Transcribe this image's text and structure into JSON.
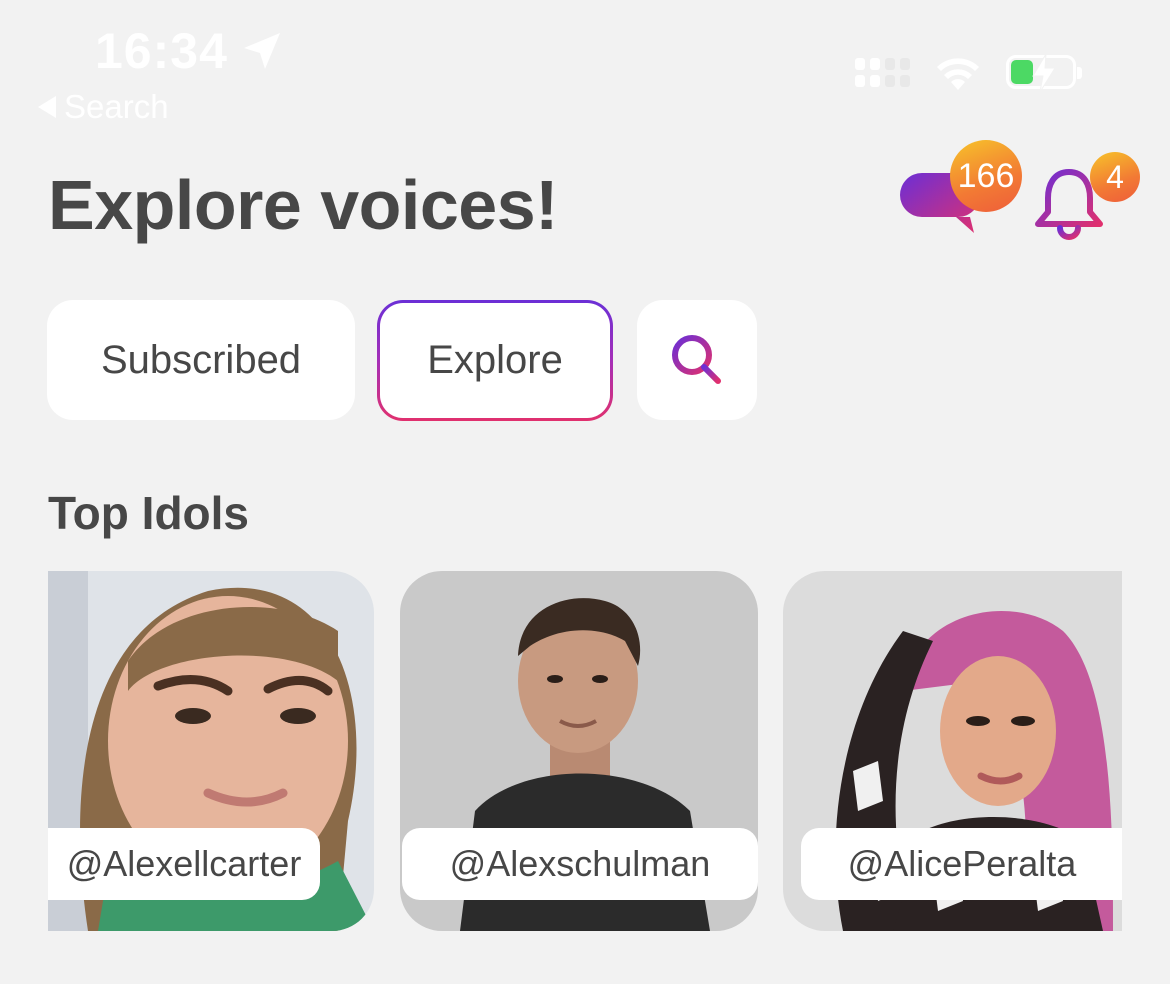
{
  "status_bar": {
    "time": "16:34",
    "back_label": "Search",
    "battery_level": 0.35
  },
  "header": {
    "title": "Explore voices!",
    "messages_badge": "166",
    "notifications_badge": "4"
  },
  "tabs": [
    {
      "label": "Subscribed",
      "active": false
    },
    {
      "label": "Explore",
      "active": true
    }
  ],
  "section": {
    "title": "Top Idols"
  },
  "idols": [
    {
      "handle": "@Alexellcarter"
    },
    {
      "handle": "@Alexschulman"
    },
    {
      "handle": "@AlicePeralta"
    }
  ],
  "colors": {
    "background": "#f2f2f2",
    "accent_purple": "#6b2fd6",
    "accent_pink": "#e0306e",
    "badge_orange": "#f27a34",
    "text": "#474747"
  }
}
